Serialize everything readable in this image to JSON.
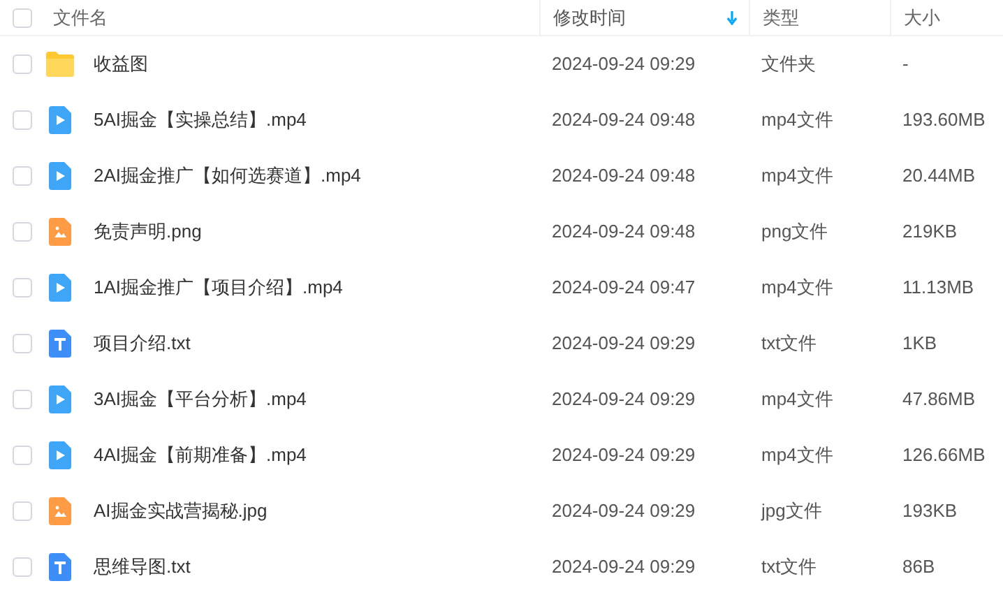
{
  "header": {
    "select_all": {
      "checked": false
    },
    "columns": [
      {
        "label": "文件名",
        "sorted": false
      },
      {
        "label": "修改时间",
        "sorted": true
      },
      {
        "label": "类型",
        "sorted": false
      },
      {
        "label": "大小",
        "sorted": false
      }
    ]
  },
  "rows": [
    {
      "kind": "folder",
      "checked": false,
      "name": "收益图",
      "modified": "2024-09-24 09:29",
      "type": "文件夹",
      "size": "-"
    },
    {
      "kind": "video",
      "checked": false,
      "name": "5AI掘金【实操总结】.mp4",
      "modified": "2024-09-24 09:48",
      "type": "mp4文件",
      "size": "193.60MB"
    },
    {
      "kind": "video",
      "checked": false,
      "name": "2AI掘金推广【如何选赛道】.mp4",
      "modified": "2024-09-24 09:48",
      "type": "mp4文件",
      "size": "20.44MB"
    },
    {
      "kind": "image",
      "checked": false,
      "name": "免责声明.png",
      "modified": "2024-09-24 09:48",
      "type": "png文件",
      "size": "219KB"
    },
    {
      "kind": "video",
      "checked": false,
      "name": "1AI掘金推广【项目介绍】.mp4",
      "modified": "2024-09-24 09:47",
      "type": "mp4文件",
      "size": "11.13MB"
    },
    {
      "kind": "text",
      "checked": false,
      "name": "项目介绍.txt",
      "modified": "2024-09-24 09:29",
      "type": "txt文件",
      "size": "1KB"
    },
    {
      "kind": "video",
      "checked": false,
      "name": "3AI掘金【平台分析】.mp4",
      "modified": "2024-09-24 09:29",
      "type": "mp4文件",
      "size": "47.86MB"
    },
    {
      "kind": "video",
      "checked": false,
      "name": "4AI掘金【前期准备】.mp4",
      "modified": "2024-09-24 09:29",
      "type": "mp4文件",
      "size": "126.66MB"
    },
    {
      "kind": "image",
      "checked": false,
      "name": "AI掘金实战营揭秘.jpg",
      "modified": "2024-09-24 09:29",
      "type": "jpg文件",
      "size": "193KB"
    },
    {
      "kind": "text",
      "checked": false,
      "name": "思维导图.txt",
      "modified": "2024-09-24 09:29",
      "type": "txt文件",
      "size": "86B"
    }
  ]
}
